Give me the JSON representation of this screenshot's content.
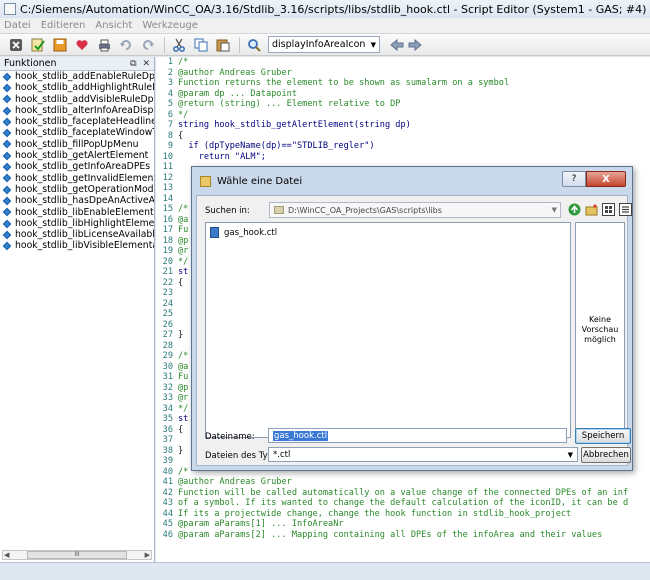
{
  "window": {
    "title": "C:/Siemens/Automation/WinCC_OA/3.16/Stdlib_3.16/scripts/libs/stdlib_hook.ctl - Script Editor (System1 - GAS; #4)"
  },
  "menu": [
    "Datei",
    "Editieren",
    "Ansicht",
    "Werkzeuge"
  ],
  "toolbar": {
    "icons": [
      "close-file-icon",
      "check-syntax-icon",
      "save-icon",
      "heart-icon",
      "print-icon",
      "undo-icon",
      "redo-icon",
      "cut-icon",
      "copy-icon",
      "paste-icon",
      "find-icon"
    ],
    "function_combo_value": "displayInfoAreaIcon"
  },
  "functions_panel": {
    "title": "Funktionen",
    "items": [
      "hook_stdlib_addEnableRuleDpes",
      "hook_stdlib_addHighlightRuleDpes",
      "hook_stdlib_addVisibleRuleDpes",
      "hook_stdlib_alterInfoAreaDisplay",
      "hook_stdlib_faceplateHeadline",
      "hook_stdlib_faceplateWindowTitle",
      "hook_stdlib_fillPopUpMenu",
      "hook_stdlib_getAlertElement",
      "hook_stdlib_getInfoAreaDPEs",
      "hook_stdlib_getInvalidElement",
      "hook_stdlib_getOperationModeElem",
      "hook_stdlib_hasDpeAnActiveAdress",
      "hook_stdlib_libEnableElementarySym",
      "hook_stdlib_libHighlightElementaryS",
      "hook_stdlib_libLicenseAvailable",
      "hook_stdlib_libVisibleElementarySym"
    ],
    "scroll_thumb_label": "III"
  },
  "editor": {
    "lines": [
      {
        "n": "1",
        "text": "/*",
        "style": "c-green"
      },
      {
        "n": "2",
        "text": "@author Andreas Gruber",
        "style": "c-green"
      },
      {
        "n": "3",
        "text": "Function returns the element to be shown as sumalarm on a symbol",
        "style": "c-green"
      },
      {
        "n": "4",
        "text": "@param dp ... Datapoint",
        "style": "c-green"
      },
      {
        "n": "5",
        "text": "@return (string) ... Element relative to DP",
        "style": "c-green"
      },
      {
        "n": "6",
        "text": "*/",
        "style": "c-green"
      },
      {
        "n": "7",
        "text": "string hook_stdlib_getAlertElement(string dp)",
        "style": "c-navy"
      },
      {
        "n": "8",
        "text": "{",
        "style": "code"
      },
      {
        "n": "9",
        "text": "  if (dpTypeName(dp)==\"STDLIB_regler\")",
        "style": "c-navy"
      },
      {
        "n": "10",
        "text": "    return \"ALM\";",
        "style": "c-navy"
      },
      {
        "n": "11",
        "text": "",
        "style": "code"
      },
      {
        "n": "12",
        "text": "",
        "style": "code"
      },
      {
        "n": "13",
        "text": "",
        "style": "code"
      },
      {
        "n": "14",
        "text": "",
        "style": "code"
      },
      {
        "n": "15",
        "text": "/*",
        "style": "c-green"
      },
      {
        "n": "16",
        "text": "@a",
        "style": "c-green"
      },
      {
        "n": "17",
        "text": "Fu",
        "style": "c-green"
      },
      {
        "n": "18",
        "text": "@p",
        "style": "c-green"
      },
      {
        "n": "19",
        "text": "@r",
        "style": "c-green"
      },
      {
        "n": "20",
        "text": "*/",
        "style": "c-green"
      },
      {
        "n": "21",
        "text": "st",
        "style": "c-navy"
      },
      {
        "n": "22",
        "text": "{",
        "style": "code"
      },
      {
        "n": "23",
        "text": "",
        "style": "code"
      },
      {
        "n": "24",
        "text": "",
        "style": "code"
      },
      {
        "n": "25",
        "text": "",
        "style": "code"
      },
      {
        "n": "26",
        "text": "",
        "style": "code"
      },
      {
        "n": "27",
        "text": "}",
        "style": "code"
      },
      {
        "n": "28",
        "text": "",
        "style": "code"
      },
      {
        "n": "29",
        "text": "/*",
        "style": "c-green"
      },
      {
        "n": "30",
        "text": "@a",
        "style": "c-green"
      },
      {
        "n": "31",
        "text": "Fu",
        "style": "c-green"
      },
      {
        "n": "32",
        "text": "@p",
        "style": "c-green"
      },
      {
        "n": "33",
        "text": "@r",
        "style": "c-green"
      },
      {
        "n": "34",
        "text": "*/",
        "style": "c-green"
      },
      {
        "n": "35",
        "text": "st",
        "style": "c-navy"
      },
      {
        "n": "36",
        "text": "{",
        "style": "code"
      },
      {
        "n": "37",
        "text": "",
        "style": "code"
      },
      {
        "n": "38",
        "text": "}",
        "style": "code"
      },
      {
        "n": "39",
        "text": "",
        "style": "code"
      },
      {
        "n": "40",
        "text": "/*",
        "style": "c-green"
      },
      {
        "n": "41",
        "text": "@author Andreas Gruber",
        "style": "c-green"
      },
      {
        "n": "42",
        "text": "Function will be called automatically on a value change of the connected DPEs of an inf",
        "style": "c-green"
      },
      {
        "n": "43",
        "text": "of a symbol. If its wanted to change the default calculation of the iconID, it can be d",
        "style": "c-green"
      },
      {
        "n": "44",
        "text": "If its a projectwide change, change the hook function in stdlib_hook_project",
        "style": "c-green"
      },
      {
        "n": "45",
        "text": "@param aParams[1] ... InfoAreaNr",
        "style": "c-green"
      },
      {
        "n": "46",
        "text": "@param aParams[2] ... Mapping containing all DPEs of the infoArea and their values",
        "style": "c-green"
      }
    ]
  },
  "dialog": {
    "title": "Wähle eine Datei",
    "help_label": "?",
    "close_label": "X",
    "look_in_label": "Suchen in:",
    "look_in_path": "D:\\WinCC_OA_Projects\\GAS\\scripts\\libs",
    "files": [
      "gas_hook.ctl"
    ],
    "preview_text": "Keine Vorschau möglich",
    "filename_label": "Dateiname:",
    "filename_value": "gas_hook.ctl",
    "filetype_label": "Dateien des Typs:",
    "filetype_value": "*.ctl",
    "save_label": "Speichern",
    "cancel_label": "Abbrechen"
  }
}
